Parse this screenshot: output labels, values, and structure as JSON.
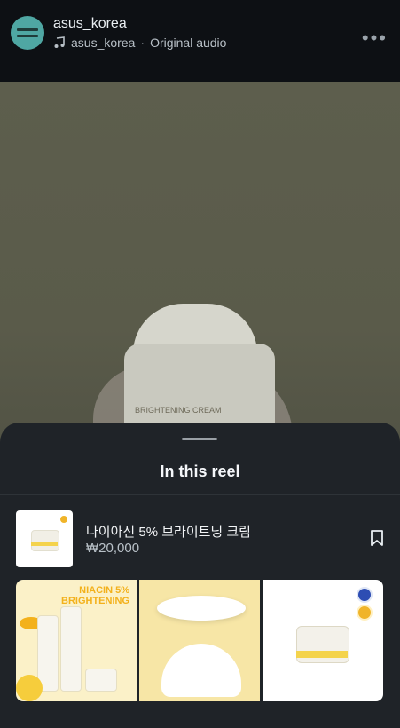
{
  "header": {
    "account_name": "asus_korea",
    "audio_account": "asus_korea",
    "audio_separator": "·",
    "audio_label": "Original audio",
    "more_icon": "more-dots-icon"
  },
  "video": {
    "jar_label": "BRIGHTENING CREAM"
  },
  "sheet": {
    "title": "In this reel"
  },
  "product": {
    "name": "나이아신 5% 브라이트닝 크림",
    "price": "₩20,000",
    "bookmark_icon": "bookmark-icon"
  },
  "gallery": {
    "tile1_title_line1": "NIACIN 5%",
    "tile1_title_line2": "BRIGHTENING"
  }
}
